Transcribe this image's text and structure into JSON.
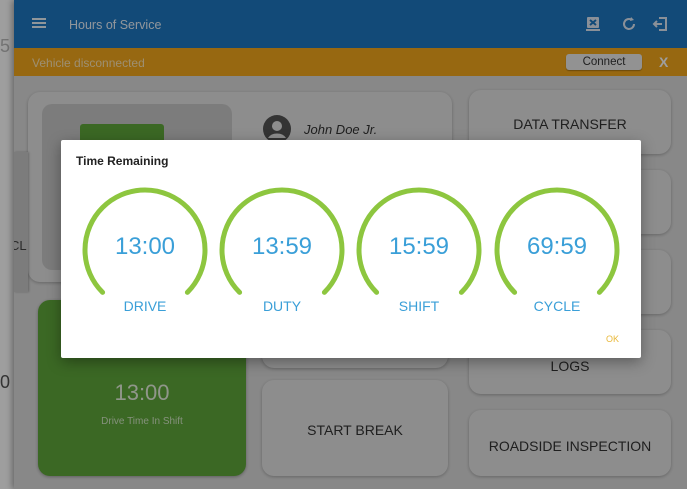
{
  "appbar": {
    "title": "Hours of Service"
  },
  "banner": {
    "message": "Vehicle disconnected",
    "connect_label": "Connect",
    "close_label": "X"
  },
  "driver": {
    "name": "John Doe Jr."
  },
  "drive_card": {
    "time": "13:00",
    "label": "Drive Time In Shift"
  },
  "buttons": {
    "data_transfer": "DATA TRANSFER",
    "logs": "LOGS",
    "start_break": "START BREAK",
    "roadside_inspection": "ROADSIDE INSPECTION"
  },
  "edge": {
    "cycle_partial": "CL",
    "left_digit_top": "5",
    "left_digit_bottom": "0"
  },
  "dialog": {
    "title": "Time Remaining",
    "ok_label": "OK",
    "gauges": [
      {
        "time": "13:00",
        "label": "DRIVE"
      },
      {
        "time": "13:59",
        "label": "DUTY"
      },
      {
        "time": "15:59",
        "label": "SHIFT"
      },
      {
        "time": "69:59",
        "label": "CYCLE"
      }
    ]
  },
  "colors": {
    "appbar": "#1e78c2",
    "banner": "#f4a81c",
    "gauge_arc": "#8dc63f",
    "gauge_text": "#3a9fd8",
    "drive_card": "#5fa83a",
    "ok": "#e9b83a"
  }
}
